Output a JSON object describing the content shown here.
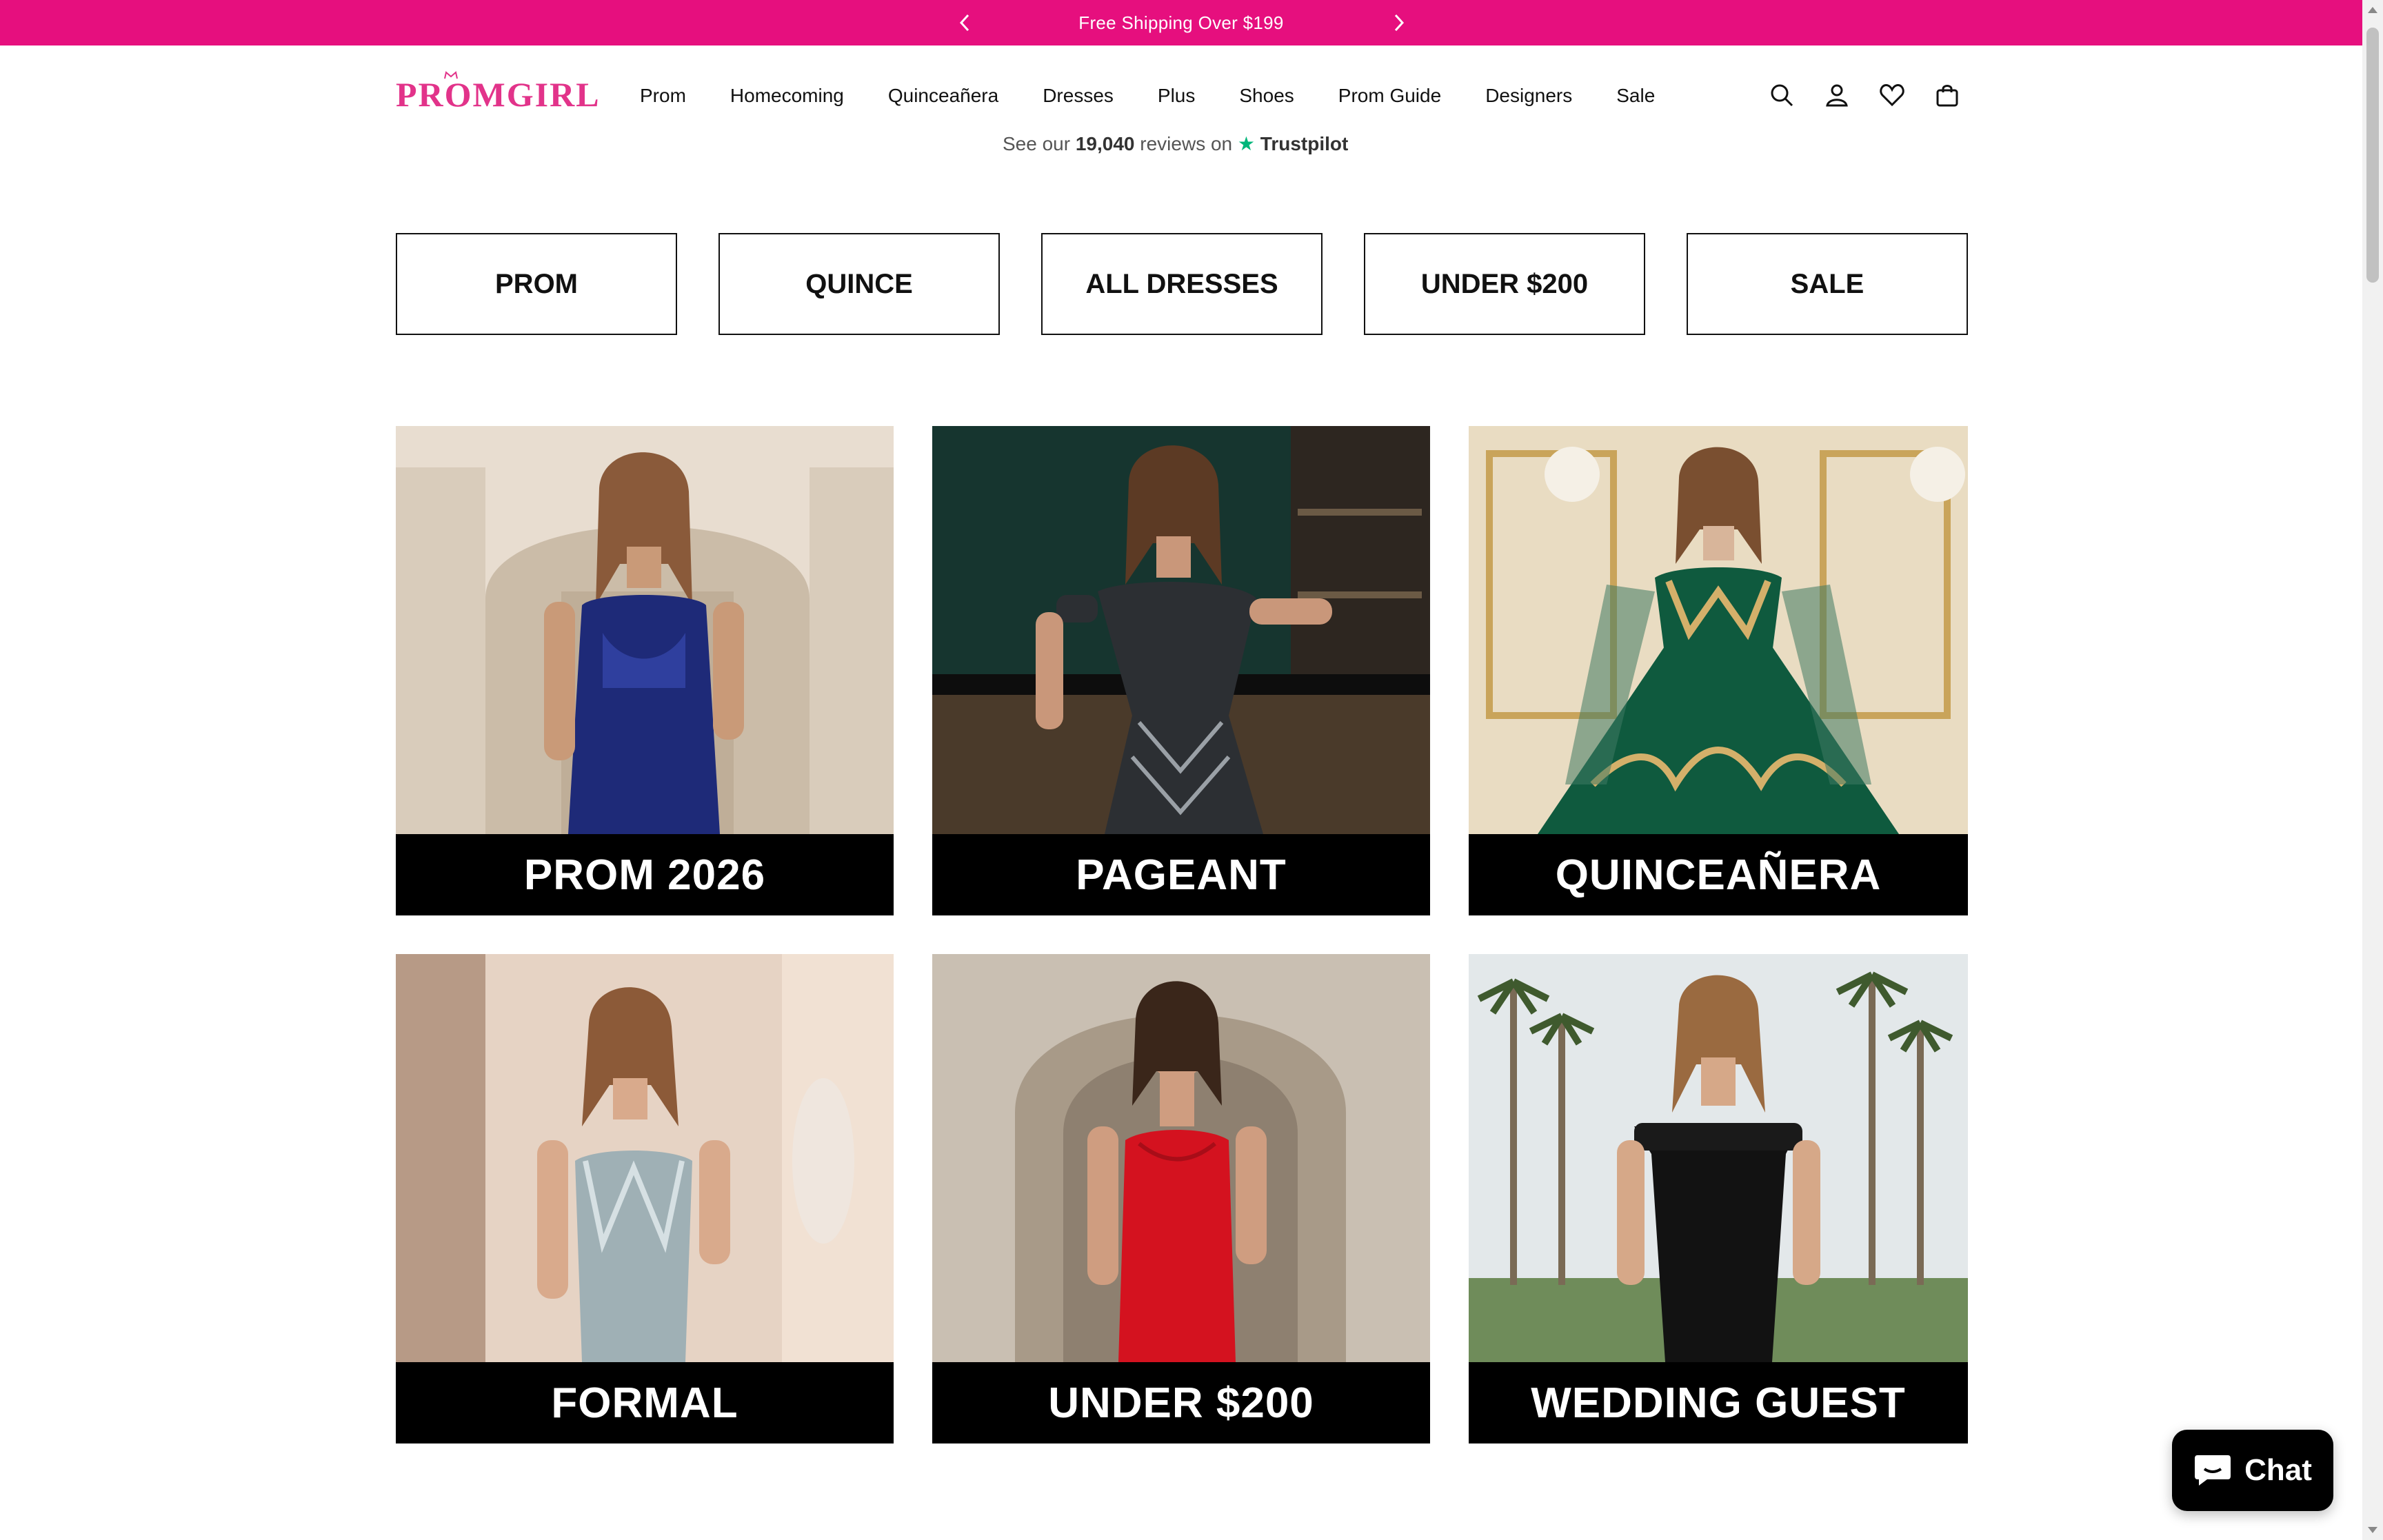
{
  "announcement": {
    "text": "Free Shipping Over $199",
    "prev_icon": "chevron-left-icon",
    "next_icon": "chevron-right-icon"
  },
  "header": {
    "logo": "PROMGIRL",
    "nav": [
      "Prom",
      "Homecoming",
      "Quinceañera",
      "Dresses",
      "Plus",
      "Shoes",
      "Prom Guide",
      "Designers",
      "Sale"
    ],
    "icons": [
      "search-icon",
      "account-icon",
      "wishlist-heart-icon",
      "cart-bag-icon"
    ]
  },
  "trustpilot": {
    "prefix": "See our",
    "count": "19,040",
    "suffix": "reviews on",
    "brand": "Trustpilot"
  },
  "category_buttons": [
    "PROM",
    "QUINCE",
    "ALL DRESSES",
    "UNDER $200",
    "SALE"
  ],
  "tiles": [
    {
      "label": "PROM 2026"
    },
    {
      "label": "PAGEANT"
    },
    {
      "label": "QUINCEAÑERA"
    },
    {
      "label": "FORMAL"
    },
    {
      "label": "UNDER $200"
    },
    {
      "label": "WEDDING GUEST"
    }
  ],
  "chat": {
    "label": "Chat",
    "icon": "chat-bubble-icon"
  },
  "colors": {
    "brand_pink": "#e60f7e",
    "logo_pink": "#e2338a"
  }
}
